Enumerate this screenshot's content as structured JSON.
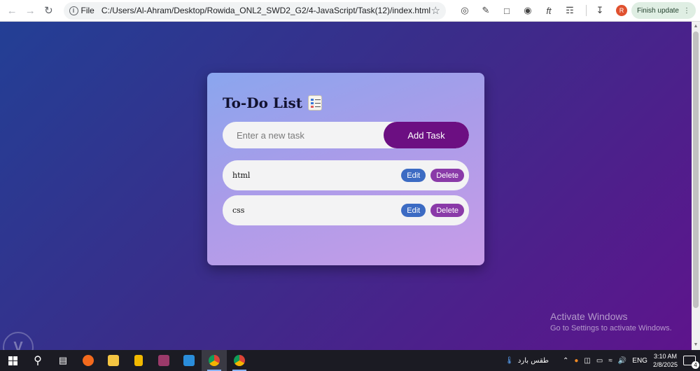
{
  "browser": {
    "scheme_label": "File",
    "url": "C:/Users/Al-Ahram/Desktop/Rowida_ONL2_SWD2_G2/4-JavaScript/Task(12)/index.html",
    "avatar_letter": "R",
    "finish_update_label": "Finish update"
  },
  "app": {
    "title": "To-Do List",
    "input_placeholder": "Enter a new task",
    "add_button_label": "Add Task",
    "tasks": [
      {
        "text": "html",
        "edit_label": "Edit",
        "delete_label": "Delete"
      },
      {
        "text": "css",
        "edit_label": "Edit",
        "delete_label": "Delete"
      }
    ],
    "colors": {
      "add_button": "#6c0f82",
      "edit_button": "#3c6bc3",
      "delete_button": "#8a3aa8"
    }
  },
  "os": {
    "activate_title": "Activate Windows",
    "activate_sub": "Go to Settings to activate Windows.",
    "weather_text": "طقس بارد",
    "language": "ENG",
    "time": "3:10 AM",
    "date": "2/8/2025",
    "notification_count": "4"
  }
}
